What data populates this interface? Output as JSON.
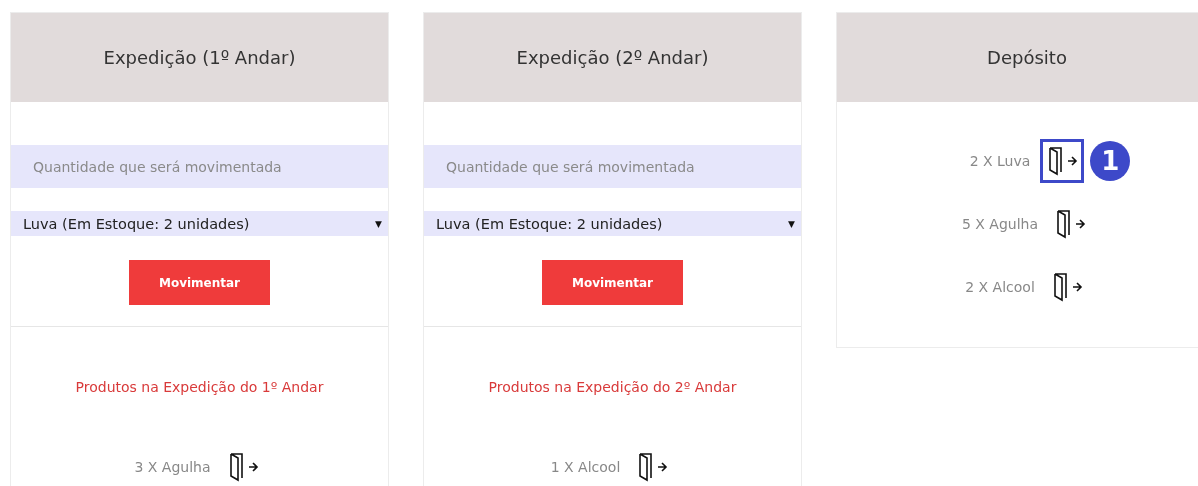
{
  "columns": [
    {
      "kind": "form",
      "title": "Expedição (1º Andar)",
      "quantity": {
        "placeholder": "Quantidade que será movimentada"
      },
      "product_select": {
        "value": "Luva (Em Estoque: 2 unidades)",
        "caret": "▼"
      },
      "button": "Movimentar",
      "list_title": "Produtos na Expedição do 1º Andar",
      "items": [
        {
          "label": "3 X Agulha",
          "highlighted": false
        }
      ]
    },
    {
      "kind": "form",
      "title": "Expedição (2º Andar)",
      "quantity": {
        "placeholder": "Quantidade que será movimentada"
      },
      "product_select": {
        "value": "Luva (Em Estoque: 2 unidades)",
        "caret": "▼"
      },
      "button": "Movimentar",
      "list_title": "Produtos na Expedição do 2º Andar",
      "items": [
        {
          "label": "1 X Alcool",
          "highlighted": false
        }
      ]
    },
    {
      "kind": "list",
      "title": "Depósito",
      "items": [
        {
          "label": "2 X Luva",
          "highlighted": true,
          "badge": "1"
        },
        {
          "label": "5 X Agulha",
          "highlighted": false
        },
        {
          "label": "2 X Alcool",
          "highlighted": false
        }
      ]
    }
  ]
}
